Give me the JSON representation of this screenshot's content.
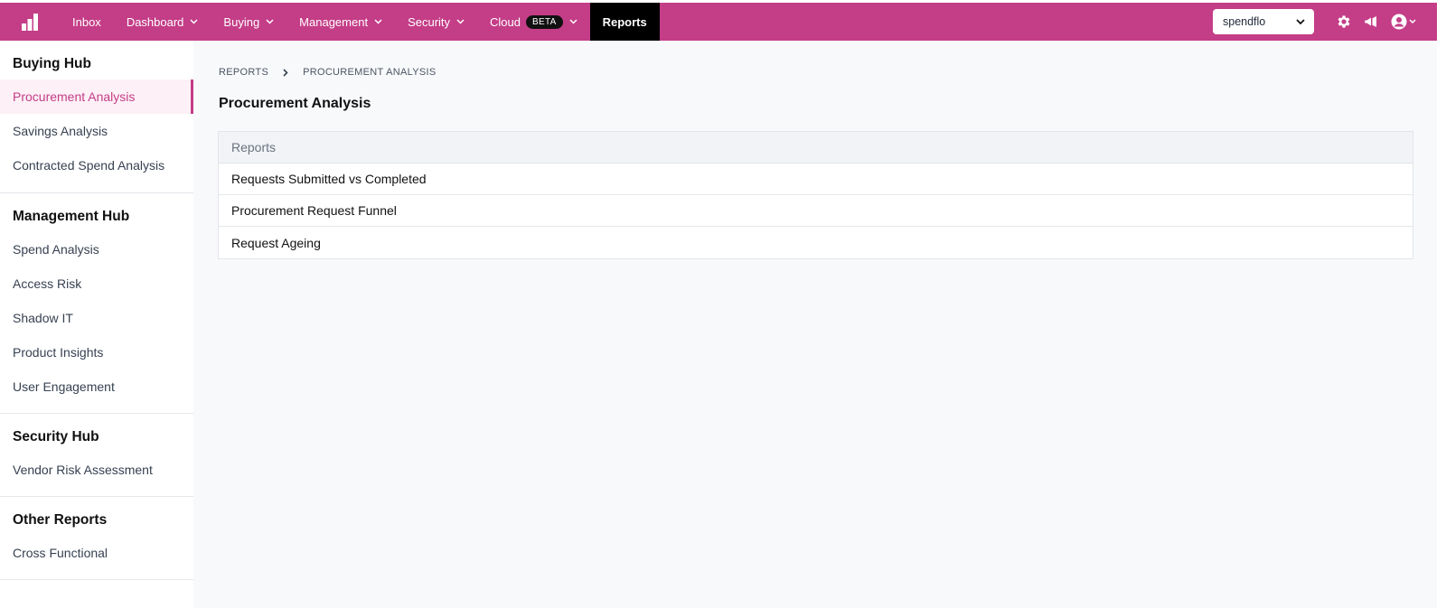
{
  "topbar": {
    "nav": [
      {
        "label": "Inbox",
        "has_chevron": false
      },
      {
        "label": "Dashboard",
        "has_chevron": true
      },
      {
        "label": "Buying",
        "has_chevron": true
      },
      {
        "label": "Management",
        "has_chevron": true
      },
      {
        "label": "Security",
        "has_chevron": true
      },
      {
        "label": "Cloud",
        "has_chevron": true,
        "badge": "BETA"
      },
      {
        "label": "Reports",
        "has_chevron": false,
        "active": true
      }
    ],
    "tenant_select": "spendflo",
    "icons": [
      "settings-gear-icon",
      "megaphone-icon",
      "user-avatar-icon"
    ]
  },
  "sidebar": {
    "groups": [
      {
        "title": "Buying Hub",
        "items": [
          "Procurement Analysis",
          "Savings Analysis",
          "Contracted Spend Analysis"
        ]
      },
      {
        "title": "Management Hub",
        "items": [
          "Spend Analysis",
          "Access Risk",
          "Shadow IT",
          "Product Insights",
          "User Engagement"
        ]
      },
      {
        "title": "Security Hub",
        "items": [
          "Vendor Risk Assessment"
        ]
      },
      {
        "title": "Other Reports",
        "items": [
          "Cross Functional"
        ]
      }
    ],
    "active_item": "Procurement Analysis"
  },
  "main": {
    "breadcrumb": [
      "REPORTS",
      "PROCUREMENT ANALYSIS"
    ],
    "title": "Procurement Analysis",
    "table": {
      "header": "Reports",
      "rows": [
        "Requests Submitted vs Completed",
        "Procurement Request Funnel",
        "Request Ageing"
      ]
    }
  },
  "colors": {
    "brand": "#c43d87",
    "active_nav": "#000000",
    "active_side_bg": "#fdf0f6"
  }
}
